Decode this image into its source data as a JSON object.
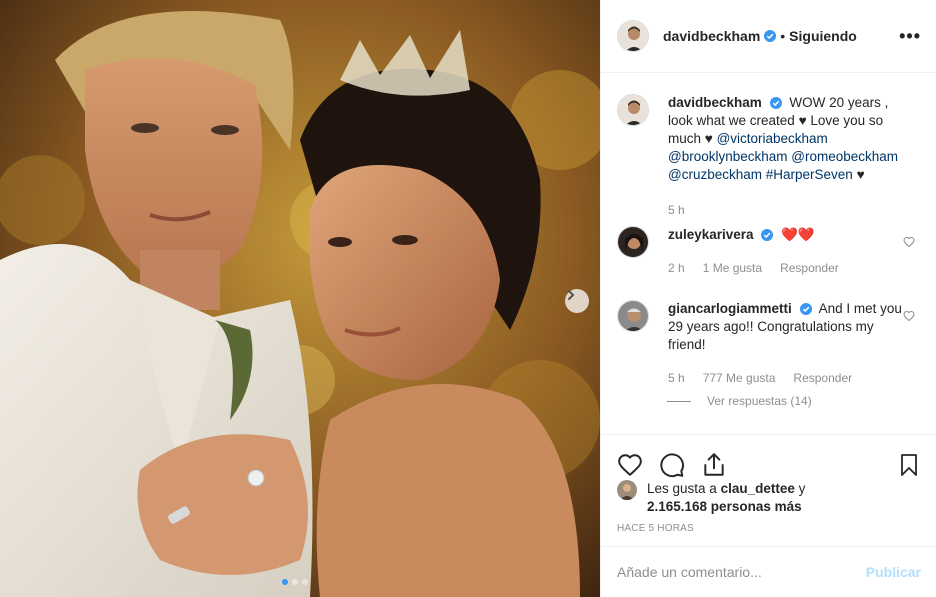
{
  "post": {
    "author": "davidbeckham",
    "follow_status": "Siguiendo",
    "separator": "•",
    "more_label": "•••"
  },
  "caption": {
    "user": "davidbeckham",
    "text_1": "WOW 20 years , look what we created",
    "heart_1": "♥",
    "text_2": "Love you so much",
    "heart_2": "♥",
    "mentions": [
      "@victoriabeckham",
      "@brooklynbeckham",
      "@romeobeckham",
      "@cruzbeckham",
      "#HarperSeven"
    ],
    "heart_3": "♥",
    "time": "5 h"
  },
  "comments": [
    {
      "user": "zuleykarivera",
      "text": "❤️❤️",
      "time": "2 h",
      "likes": "1 Me gusta",
      "reply": "Responder"
    },
    {
      "user": "giancarlogiammetti",
      "text": "And I met you 29 years ago!! Congratulations my friend!",
      "time": "5 h",
      "likes": "777 Me gusta",
      "reply": "Responder",
      "view_replies": "Ver respuestas (14)"
    }
  ],
  "likes": {
    "prefix": "Les gusta a",
    "user": "clau_dettee",
    "conj": "y",
    "count": "2.165.168 personas más"
  },
  "timestamp": "HACE 5 HORAS",
  "comment_box": {
    "placeholder": "Añade un comentario...",
    "publish": "Publicar"
  },
  "colors": {
    "verified": "#3897f0",
    "mention": "#003569",
    "publish_disabled": "#b2dffc",
    "heart_red": "#ed4956"
  },
  "icons": [
    "heart-icon",
    "comment-icon",
    "share-icon",
    "bookmark-icon",
    "verified-badge-icon",
    "chevron-right-icon"
  ]
}
